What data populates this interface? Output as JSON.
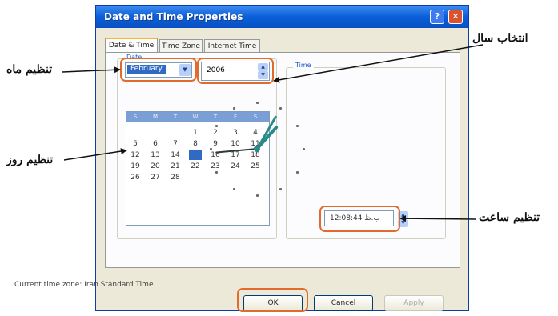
{
  "dialog": {
    "title": "Date and Time Properties",
    "help_symbol": "?",
    "close_symbol": "✕",
    "tabs": [
      "Date & Time",
      "Time Zone",
      "Internet Time"
    ],
    "active_tab": "Date & Time"
  },
  "date_group": {
    "label": "Date",
    "month": "February",
    "year": "2006",
    "calendar": {
      "day_headers": [
        "S",
        "M",
        "T",
        "W",
        "T",
        "F",
        "S"
      ],
      "days": [
        "1",
        "2",
        "3",
        "4",
        "5",
        "6",
        "7",
        "8",
        "9",
        "10",
        "11",
        "12",
        "13",
        "14",
        "15",
        "16",
        "17",
        "18",
        "19",
        "20",
        "21",
        "22",
        "23",
        "24",
        "25",
        "26",
        "27",
        "28"
      ],
      "selected_day": "15"
    }
  },
  "time_group": {
    "label": "Time",
    "time_value": "12:08:44 ب.ظ"
  },
  "timezone_text": "Current time zone: Iran Standard Time",
  "buttons": {
    "ok": "OK",
    "cancel": "Cancel",
    "apply": "Apply"
  },
  "annotations": {
    "year_select": "انتخاب سال",
    "month_set": "تنظیم ماه",
    "day_set": "تنظیم روز",
    "time_set": "تنظیم ساعت"
  },
  "colors": {
    "highlight": "#e16b2b",
    "title_bar": "#0a5fd8",
    "clock_hand": "#2a8a8a"
  }
}
